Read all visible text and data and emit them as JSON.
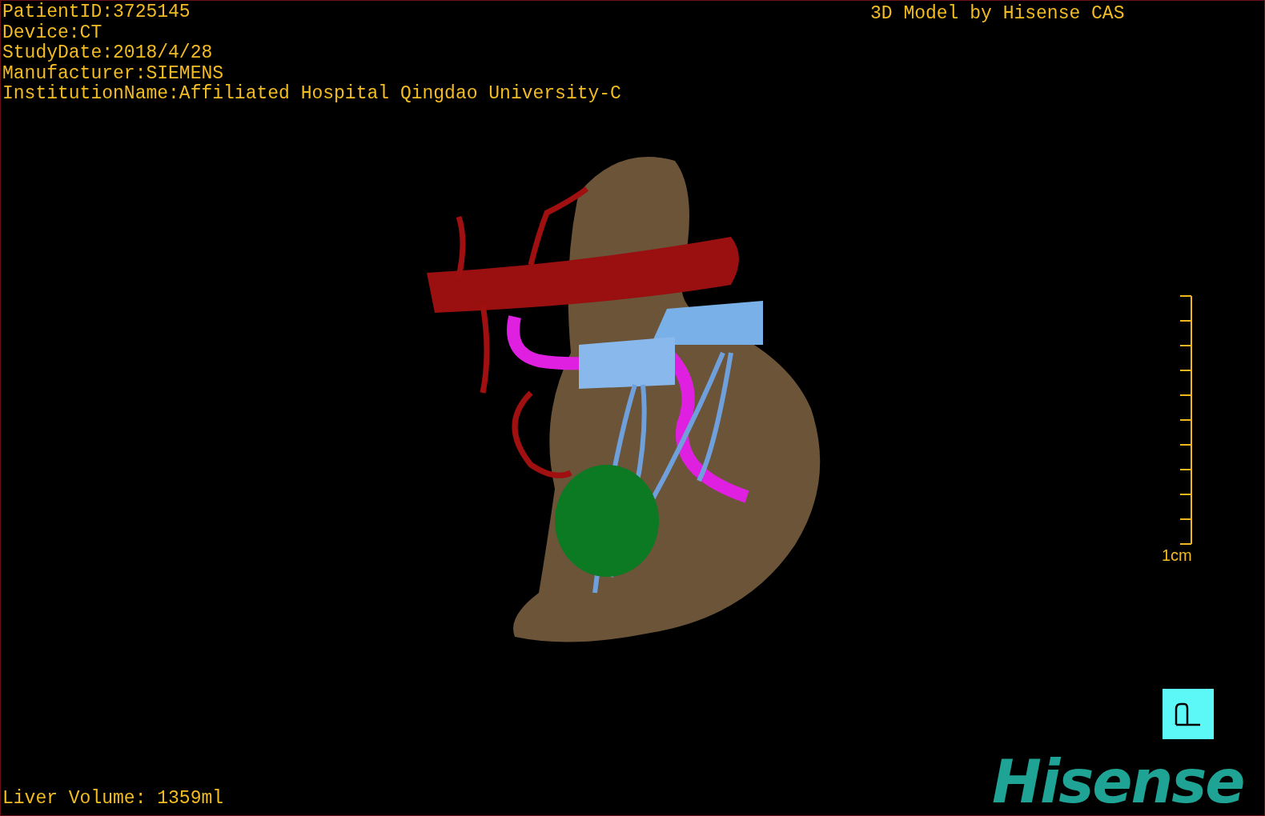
{
  "study_info": [
    "PatientID:3725145",
    "Device:CT",
    "StudyDate:2018/4/28",
    "Manufacturer:SIEMENS",
    "InstitutionName:Affiliated Hospital Qingdao University-C"
  ],
  "model_credit": "3D Model by Hisense CAS",
  "scale_bar": {
    "label": "1cm"
  },
  "liver_volume": "Liver Volume: 1359ml",
  "logo": "Hisense"
}
